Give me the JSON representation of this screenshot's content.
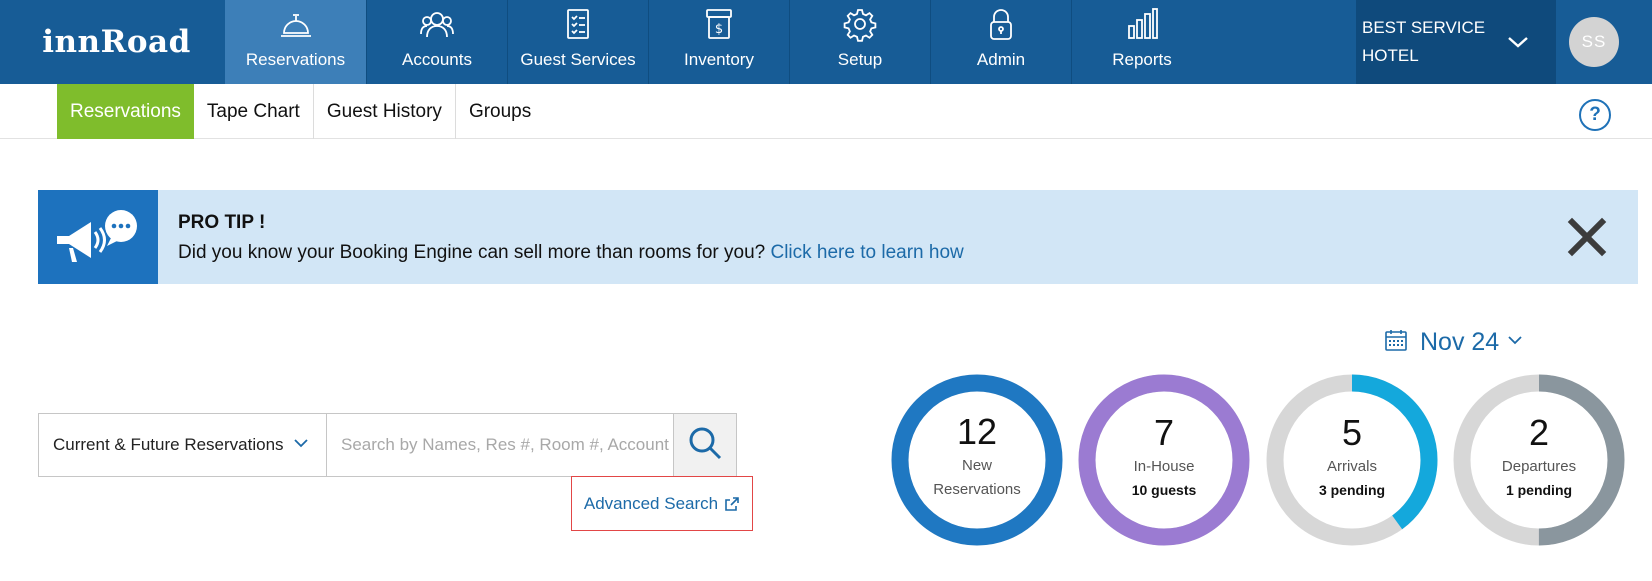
{
  "app": {
    "logo": "innRoad"
  },
  "topnav": {
    "items": [
      {
        "label": "Reservations",
        "icon": "service-bell-icon"
      },
      {
        "label": "Accounts",
        "icon": "users-icon"
      },
      {
        "label": "Guest Services",
        "icon": "clipboard-list-icon"
      },
      {
        "label": "Inventory",
        "icon": "dollar-box-icon"
      },
      {
        "label": "Setup",
        "icon": "gear-icon"
      },
      {
        "label": "Admin",
        "icon": "lock-icon"
      },
      {
        "label": "Reports",
        "icon": "bar-chart-icon"
      }
    ],
    "hotel_line1": "BEST SERVICE",
    "hotel_line2": "HOTEL",
    "avatar_initials": "SS"
  },
  "subnav": {
    "tabs": [
      {
        "label": "Reservations",
        "active": true
      },
      {
        "label": "Tape Chart",
        "active": false
      },
      {
        "label": "Guest History",
        "active": false
      },
      {
        "label": "Groups",
        "active": false
      }
    ],
    "help_label": "?"
  },
  "protip": {
    "title": "PRO TIP !",
    "text": "Did you know your Booking Engine can sell more than rooms for you? ",
    "link": "Click here to learn how"
  },
  "search": {
    "filter_value": "Current & Future Reservations",
    "placeholder": "Search by Names, Res #, Room #, Account",
    "advanced_label": "Advanced Search"
  },
  "date": {
    "label": "Nov 24"
  },
  "stats": [
    {
      "number": "12",
      "label_line1": "New",
      "label_line2": "Reservations",
      "sub": "",
      "color": "#1f78c2",
      "fraction": 1.0
    },
    {
      "number": "7",
      "label_line1": "In-House",
      "label_line2": "",
      "sub": "10 guests",
      "color": "#9b7bd2",
      "fraction": 1.0
    },
    {
      "number": "5",
      "label_line1": "Arrivals",
      "label_line2": "",
      "sub": "3 pending",
      "color": "#14a8dc",
      "fraction": 0.4
    },
    {
      "number": "2",
      "label_line1": "Departures",
      "label_line2": "",
      "sub": "1 pending",
      "color": "#8a969e",
      "fraction": 0.5
    }
  ],
  "colors": {
    "nav_bg": "#175c96",
    "nav_active": "#3d7fb8",
    "tab_active": "#7fbd2c",
    "link": "#1c6aa8",
    "ring_track": "#d7d7d7"
  }
}
